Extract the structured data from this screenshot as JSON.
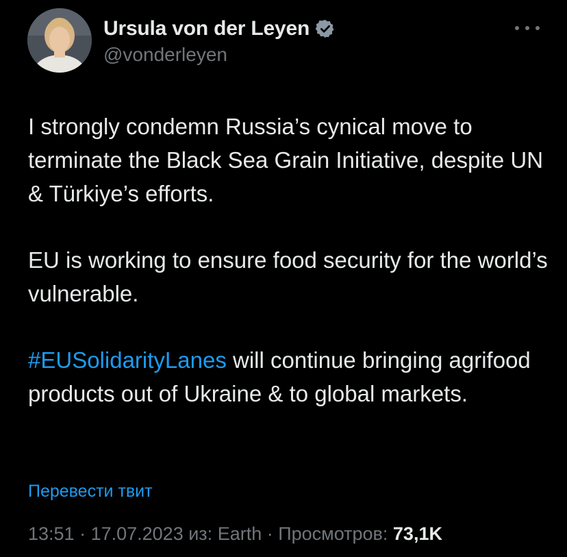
{
  "author": {
    "display_name": "Ursula von der Leyen",
    "handle": "@vonderleyen",
    "verified_icon": "verified-badge-icon",
    "avatar_icon": "profile-photo"
  },
  "more_icon": "more-options-icon",
  "tweet": {
    "paragraphs": [
      "I strongly condemn Russia’s cynical move to terminate the Black Sea Grain Initiative, despite UN & Türkiye’s efforts.",
      "EU is working to ensure food security for the world’s vulnerable."
    ],
    "hashtag": "#EUSolidarityLanes",
    "hashtag_rest": " will continue bringing agrifood products out of Ukraine & to global markets."
  },
  "translate_label": "Перевести твит",
  "meta": {
    "time": "13:51",
    "sep1": " · ",
    "date": "17.07.2023",
    "source_prefix": " из: ",
    "source": "Earth",
    "sep2": " · ",
    "views_label": "Просмотров: ",
    "views_count": "73,1K"
  },
  "colors": {
    "background": "#000000",
    "text": "#e7e9ea",
    "secondary": "#71767b",
    "accent": "#1d9bf0"
  }
}
